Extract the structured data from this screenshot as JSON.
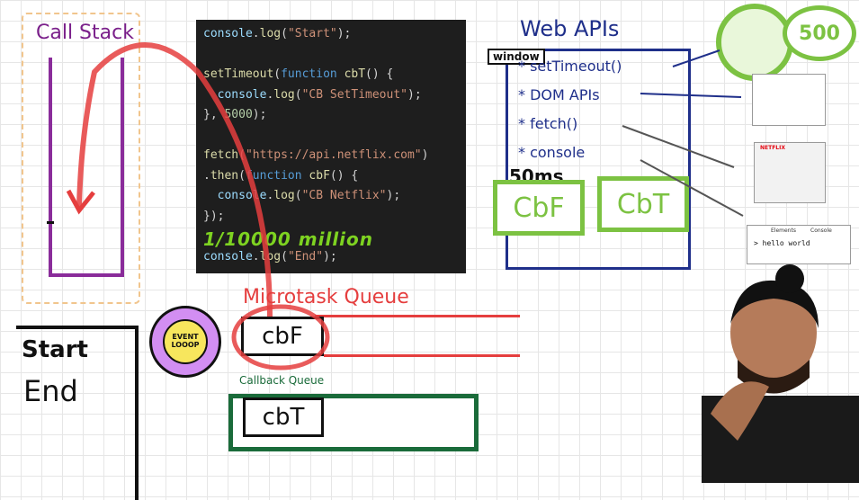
{
  "call_stack": {
    "title": "Call Stack"
  },
  "code": {
    "lines": [
      {
        "parts": [
          {
            "t": "console",
            "c": "obj"
          },
          {
            "t": ".",
            "c": ""
          },
          {
            "t": "log",
            "c": "fn"
          },
          {
            "t": "(",
            "c": ""
          },
          {
            "t": "\"Start\"",
            "c": "str"
          },
          {
            "t": ");",
            "c": ""
          }
        ]
      },
      {
        "parts": []
      },
      {
        "parts": [
          {
            "t": "setTimeout",
            "c": "fn"
          },
          {
            "t": "(",
            "c": ""
          },
          {
            "t": "function",
            "c": "kw"
          },
          {
            "t": " ",
            "c": ""
          },
          {
            "t": "cbT",
            "c": "fn"
          },
          {
            "t": "() {",
            "c": ""
          }
        ]
      },
      {
        "parts": [
          {
            "t": "  console",
            "c": "obj"
          },
          {
            "t": ".",
            "c": ""
          },
          {
            "t": "log",
            "c": "fn"
          },
          {
            "t": "(",
            "c": ""
          },
          {
            "t": "\"CB SetTimeout\"",
            "c": "str"
          },
          {
            "t": ");",
            "c": ""
          }
        ]
      },
      {
        "parts": [
          {
            "t": "}, ",
            "c": ""
          },
          {
            "t": "5000",
            "c": "num"
          },
          {
            "t": ");",
            "c": ""
          }
        ]
      },
      {
        "parts": []
      },
      {
        "parts": [
          {
            "t": "fetch",
            "c": "fn"
          },
          {
            "t": "(",
            "c": ""
          },
          {
            "t": "\"https://api.netflix.com\"",
            "c": "str"
          },
          {
            "t": ")",
            "c": ""
          }
        ]
      },
      {
        "parts": [
          {
            "t": ".",
            "c": ""
          },
          {
            "t": "then",
            "c": "fn"
          },
          {
            "t": "(",
            "c": ""
          },
          {
            "t": "function",
            "c": "kw"
          },
          {
            "t": " ",
            "c": ""
          },
          {
            "t": "cbF",
            "c": "fn"
          },
          {
            "t": "() {",
            "c": ""
          }
        ]
      },
      {
        "parts": [
          {
            "t": "  console",
            "c": "obj"
          },
          {
            "t": ".",
            "c": ""
          },
          {
            "t": "log",
            "c": "fn"
          },
          {
            "t": "(",
            "c": ""
          },
          {
            "t": "\"CB Netflix\"",
            "c": "str"
          },
          {
            "t": ");",
            "c": ""
          }
        ]
      },
      {
        "parts": [
          {
            "t": "});",
            "c": ""
          }
        ]
      },
      {
        "parts": []
      },
      {
        "parts": [
          {
            "t": "console",
            "c": "obj"
          },
          {
            "t": ".",
            "c": ""
          },
          {
            "t": "log",
            "c": "fn"
          },
          {
            "t": "(",
            "c": ""
          },
          {
            "t": "\"End\"",
            "c": "str"
          },
          {
            "t": ");",
            "c": ""
          }
        ]
      }
    ],
    "annotation": "1/10000 million"
  },
  "web_apis": {
    "title": "Web APIs",
    "window_label": "window",
    "items": [
      "* setTimeout()",
      "* DOM APIs",
      "* fetch()",
      "* console"
    ],
    "timer_label": "50ms",
    "callbacks": [
      "CbF",
      "CbT"
    ]
  },
  "timer": {
    "value": "500"
  },
  "microtask_queue": {
    "title": "Microtask Queue",
    "items": [
      "cbF"
    ]
  },
  "callback_queue": {
    "title": "Callback Queue",
    "items": [
      "cbT"
    ]
  },
  "event_loop": {
    "line1": "EVENT",
    "line2": "LOOOP"
  },
  "console_output": {
    "lines": [
      "Start",
      "End"
    ]
  },
  "thumbnails": {
    "netflix_label": "NETFLIX",
    "devtools_tabs": [
      "Elements",
      "Console"
    ],
    "console_text": "> hello world"
  },
  "colors": {
    "call_stack": "#8a2c9a",
    "web_apis": "#1f2f8a",
    "green": "#7cc242",
    "microtask": "#e53e3e",
    "callback_queue": "#1a6b3a",
    "arrow": "#e53e3e"
  }
}
